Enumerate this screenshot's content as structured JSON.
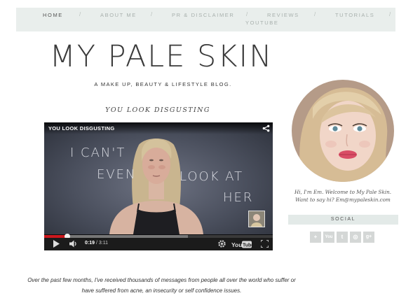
{
  "nav": {
    "items": [
      "HOME",
      "ABOUT ME",
      "PR & DISCLAIMER",
      "REVIEWS",
      "TUTORIALS",
      "YOUTUBE"
    ],
    "separator": "/"
  },
  "header": {
    "title": "MY PALE SKIN",
    "tagline": "A MAKE UP, BEAUTY & LIFESTYLE BLOG."
  },
  "post": {
    "title": "YOU LOOK DISGUSTING",
    "excerpt_line1": "Over the past few months, I've received thousands of messages from people all over the world who suffer or",
    "excerpt_line2": "have suffered from acne, an insecurity or self confidence issues."
  },
  "video": {
    "title": "YOU LOOK DISGUSTING",
    "overlay_text": [
      "I CAN'T",
      "EVEN",
      "LOOK AT",
      "HER"
    ],
    "current_time": "0:19",
    "duration": "/ 3:11",
    "progress_played": 0.1,
    "progress_loaded": 0.63,
    "icons": [
      "share-icon",
      "play-icon",
      "volume-icon",
      "settings-icon",
      "youtube-logo",
      "fullscreen-icon"
    ]
  },
  "sidebar": {
    "bio_line1": "Hi, I'm Em. Welcome to My Pale Skin.",
    "bio_line2": "Want to say hi? Em@mypaleskin.com",
    "social_heading": "SOCIAL",
    "social_icons": [
      "google-plus-icon",
      "youtube-icon",
      "twitter-icon",
      "instagram-icon",
      "google-plus-icon"
    ],
    "social_glyphs": [
      "+",
      "You",
      "t",
      "◎",
      "g+"
    ]
  },
  "colors": {
    "nav_bg": "#e9eeec",
    "social_bg": "#e3eae8",
    "progress_red": "#cc181e"
  }
}
